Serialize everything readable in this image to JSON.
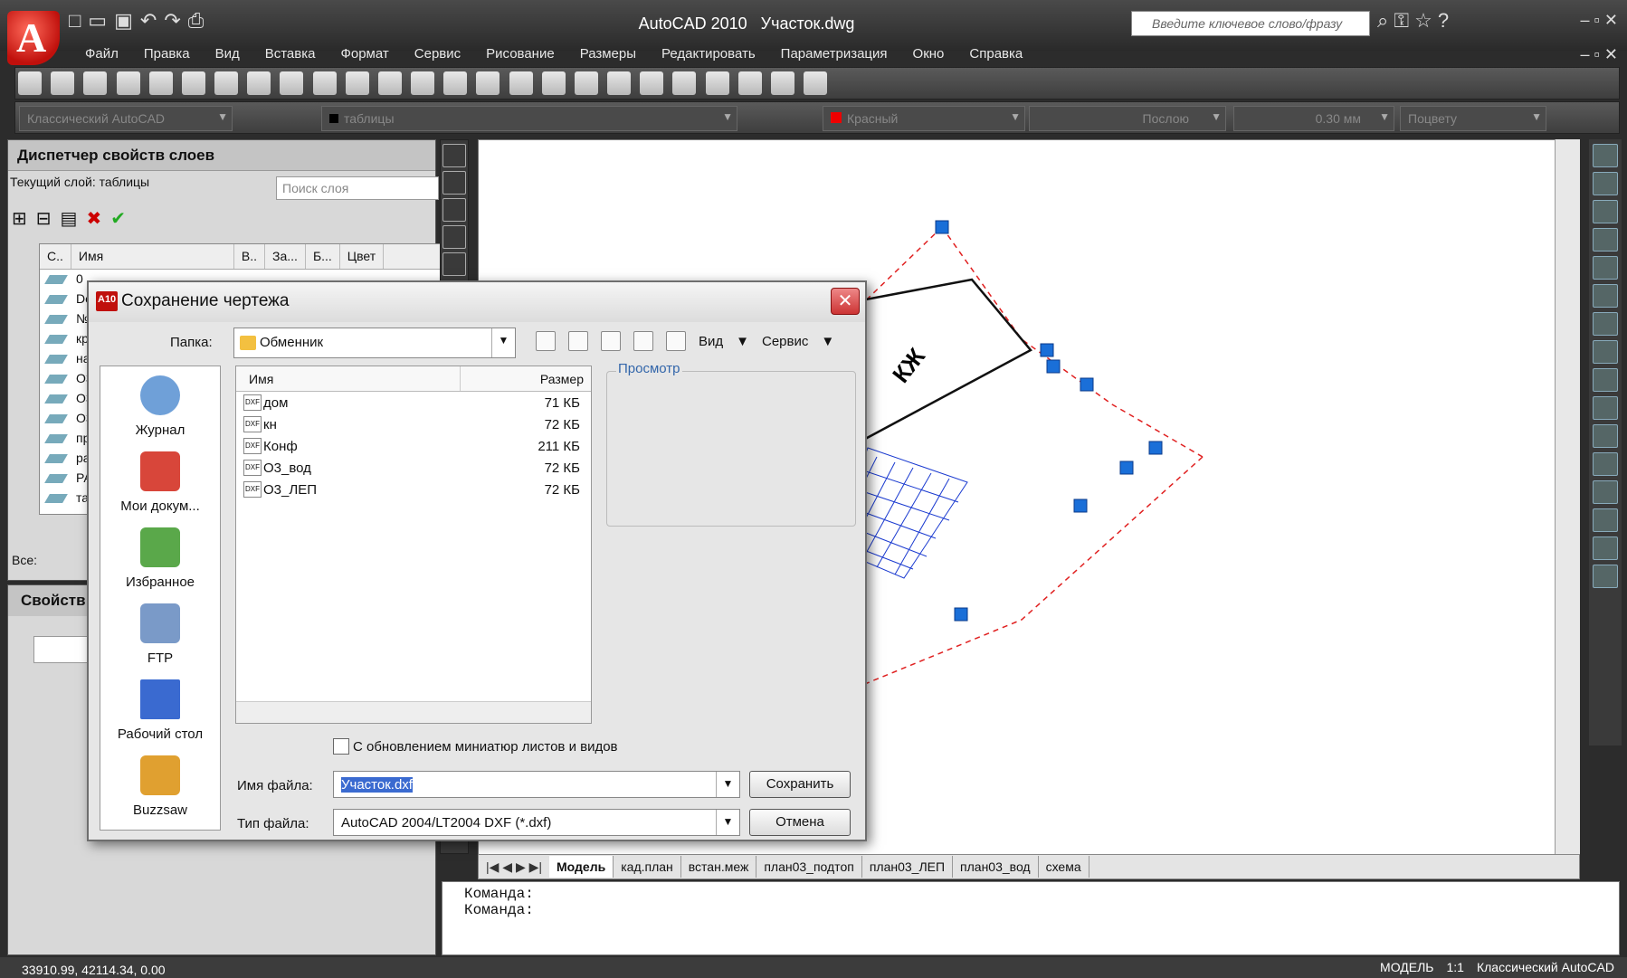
{
  "app": {
    "logo_letter": "A",
    "title": "AutoCAD 2010",
    "document": "Участок.dwg",
    "search_placeholder": "Введите ключевое слово/фразу",
    "menu": [
      "Файл",
      "Правка",
      "Вид",
      "Вставка",
      "Формат",
      "Сервис",
      "Рисование",
      "Размеры",
      "Редактировать",
      "Параметризация",
      "Окно",
      "Справка"
    ]
  },
  "toolbar2": {
    "workspace": "Классический AutoCAD",
    "layer": "таблицы",
    "color": "Красный",
    "linetype": "Послою",
    "lineweight": "0.30 мм",
    "plotstyle": "Поцвету"
  },
  "layer_panel": {
    "title": "Диспетчер свойств слоев",
    "current_layer": "Текущий слой: таблицы",
    "search_placeholder": "Поиск слоя",
    "columns": [
      "С..",
      "Имя",
      "В..",
      "За...",
      "Б...",
      "Цвет"
    ],
    "rows": [
      "0",
      "De",
      "№",
      "кр",
      "на",
      "О3",
      "О3",
      "О3",
      "пр",
      "ра",
      "РА",
      "та"
    ],
    "filter_label": "Все:"
  },
  "props_panel": {
    "title": "Свойств"
  },
  "dialog": {
    "logo": "A10",
    "title": "Сохранение чертежа",
    "folder_label": "Папка:",
    "folder": "Обменник",
    "view_label": "Вид",
    "tools_label": "Сервис",
    "places": [
      "Журнал",
      "Мои докум...",
      "Избранное",
      "FTP",
      "Рабочий стол",
      "Buzzsaw"
    ],
    "place_colors": [
      "#6fa0d8",
      "#d8463a",
      "#5aa84a",
      "#7a9ac8",
      "#3a6ad0",
      "#e0a030"
    ],
    "list_header_name": "Имя",
    "list_header_size": "Размер",
    "files": [
      {
        "name": "дом",
        "size": "71 КБ"
      },
      {
        "name": "кн",
        "size": "72 КБ"
      },
      {
        "name": "Конф",
        "size": "211 КБ"
      },
      {
        "name": "О3_вод",
        "size": "72 КБ"
      },
      {
        "name": "О3_ЛЕП",
        "size": "72 КБ"
      }
    ],
    "preview_label": "Просмотр",
    "update_thumbs": "С обновлением миниатюр листов и видов",
    "filename_label": "Имя файла:",
    "filename": "Участок.dxf",
    "filetype_label": "Тип файла:",
    "filetype": "AutoCAD 2004/LT2004 DXF (*.dxf)",
    "save_btn": "Сохранить",
    "cancel_btn": "Отмена"
  },
  "drawing": {
    "label": "КЖ"
  },
  "layout_tabs": [
    "Модель",
    "кад.план",
    "встан.меж",
    "план03_подтоп",
    "план03_ЛЕП",
    "план03_вод",
    "схема"
  ],
  "command": {
    "line1": "Команда:",
    "line2": "Команда:"
  },
  "status": {
    "coords": "33910.99, 42114.34, 0.00",
    "model": "МОДЕЛЬ",
    "scale": "1:1",
    "workspace": "Классический AutoCAD"
  }
}
